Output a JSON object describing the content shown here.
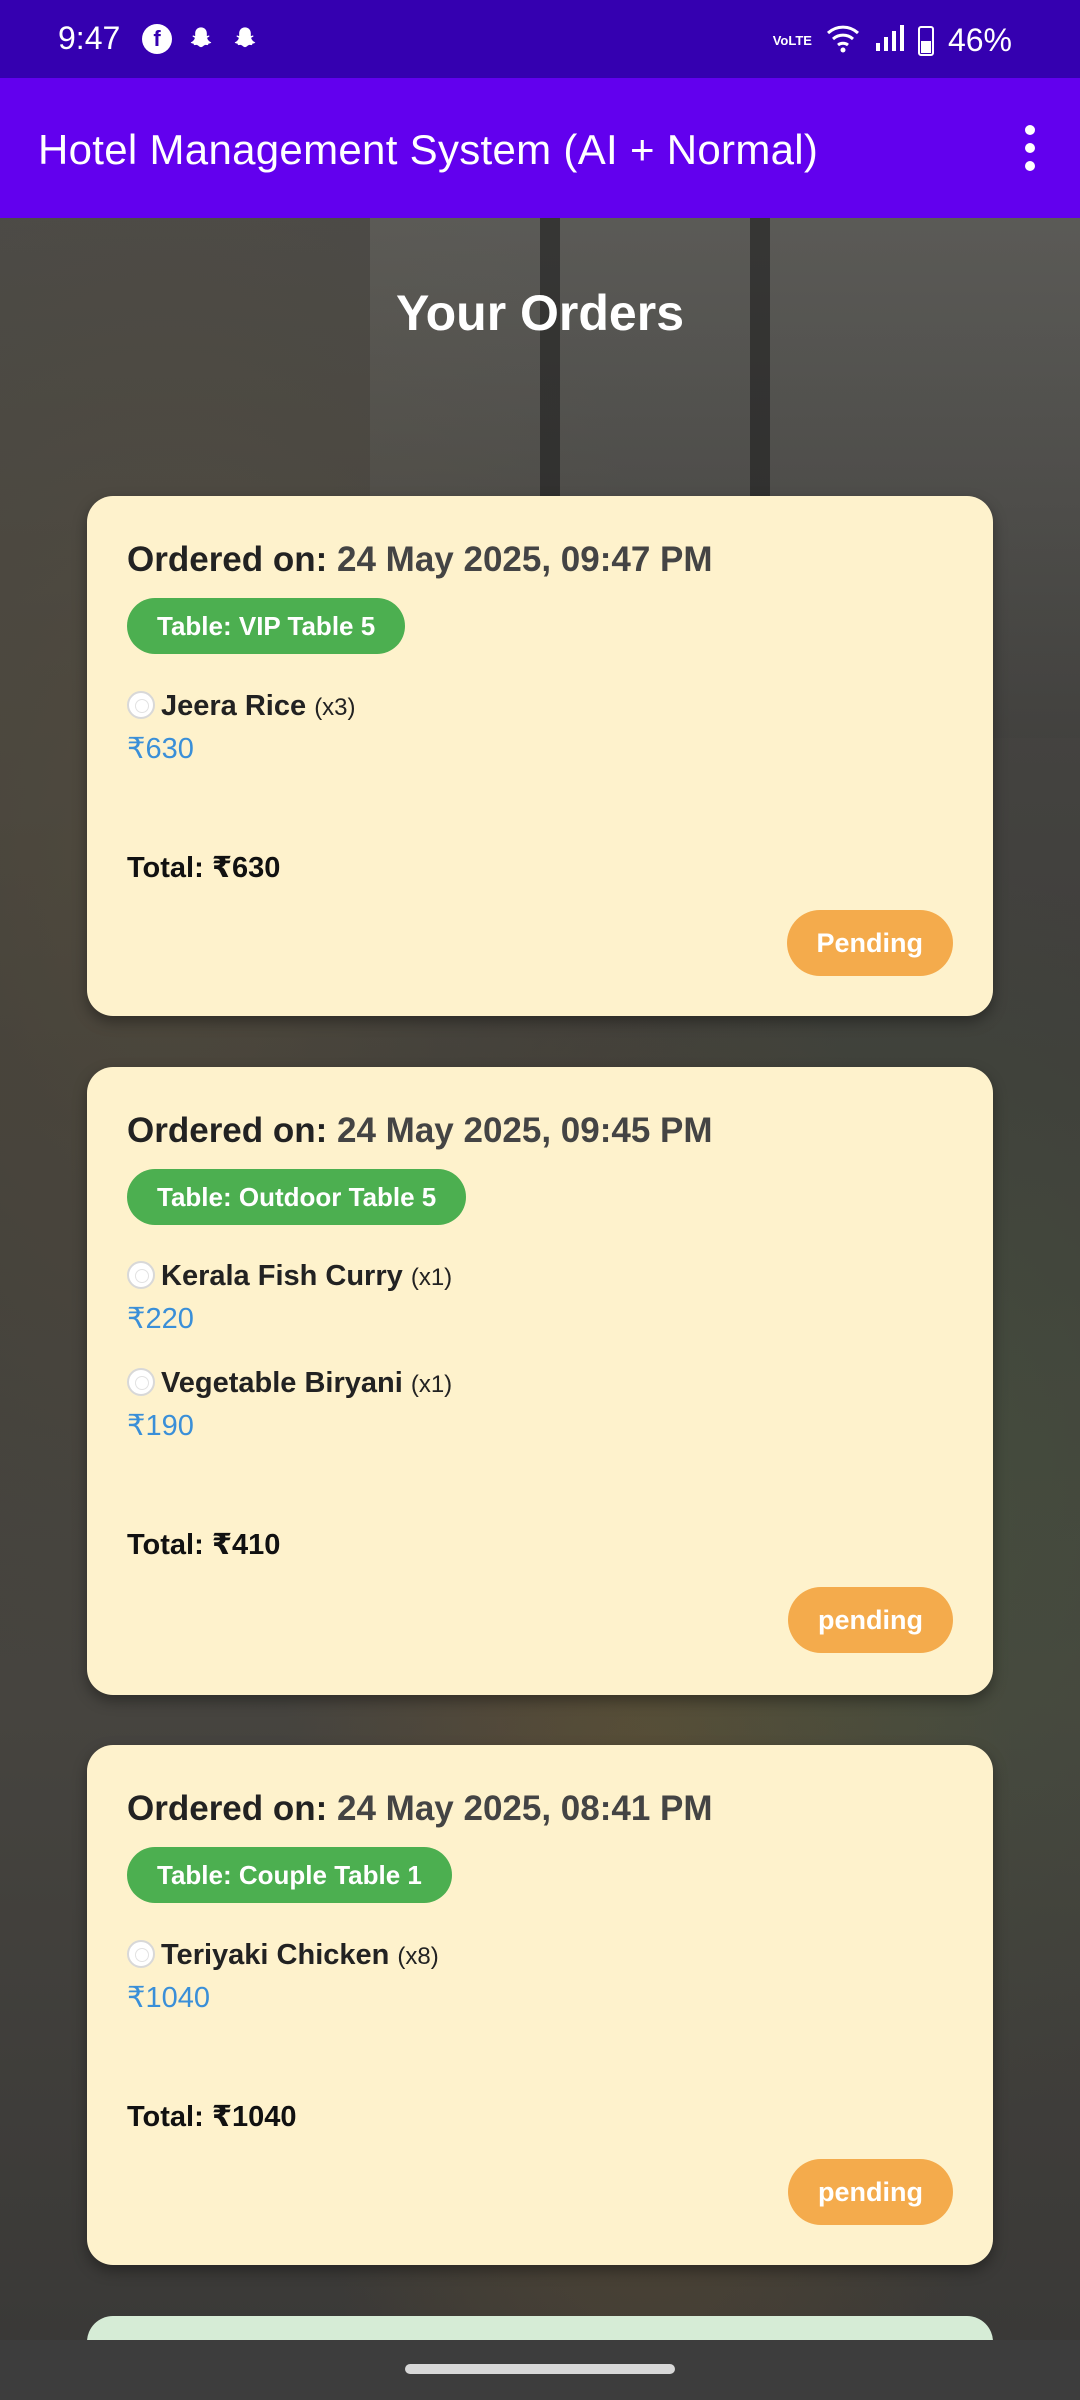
{
  "status_bar": {
    "time": "9:47",
    "app_icons": [
      "facebook-icon",
      "snapchat-icon",
      "snapchat-icon"
    ],
    "network": "VoLTE",
    "battery": "46%"
  },
  "app_bar": {
    "title": "Hotel Management System (AI + Normal)"
  },
  "page": {
    "heading": "Your Orders"
  },
  "orders": [
    {
      "date_label": "Ordered on:",
      "date": "24 May 2025, 09:47 PM",
      "table": "Table: VIP Table 5",
      "items": [
        {
          "name": "Jeera Rice",
          "qty": "(x3)",
          "price": "₹630"
        }
      ],
      "total": "Total: ₹630",
      "status": "Pending"
    },
    {
      "date_label": "Ordered on:",
      "date": "24 May 2025, 09:45 PM",
      "table": "Table: Outdoor Table 5",
      "items": [
        {
          "name": "Kerala Fish Curry",
          "qty": "(x1)",
          "price": "₹220"
        },
        {
          "name": "Vegetable Biryani",
          "qty": "(x1)",
          "price": "₹190"
        }
      ],
      "total": "Total: ₹410",
      "status": "pending"
    },
    {
      "date_label": "Ordered on:",
      "date": "24 May 2025, 08:41 PM",
      "table": "Table: Couple Table 1",
      "items": [
        {
          "name": "Teriyaki Chicken",
          "qty": "(x8)",
          "price": "₹1040"
        }
      ],
      "total": "Total: ₹1040",
      "status": "pending"
    }
  ],
  "colors": {
    "status_bar": "#3500b0",
    "app_bar": "#6200ee",
    "card": "#fef2cc",
    "table_badge": "#4caf50",
    "status_pill": "#f4ab4c",
    "price": "#3a8fd8"
  }
}
